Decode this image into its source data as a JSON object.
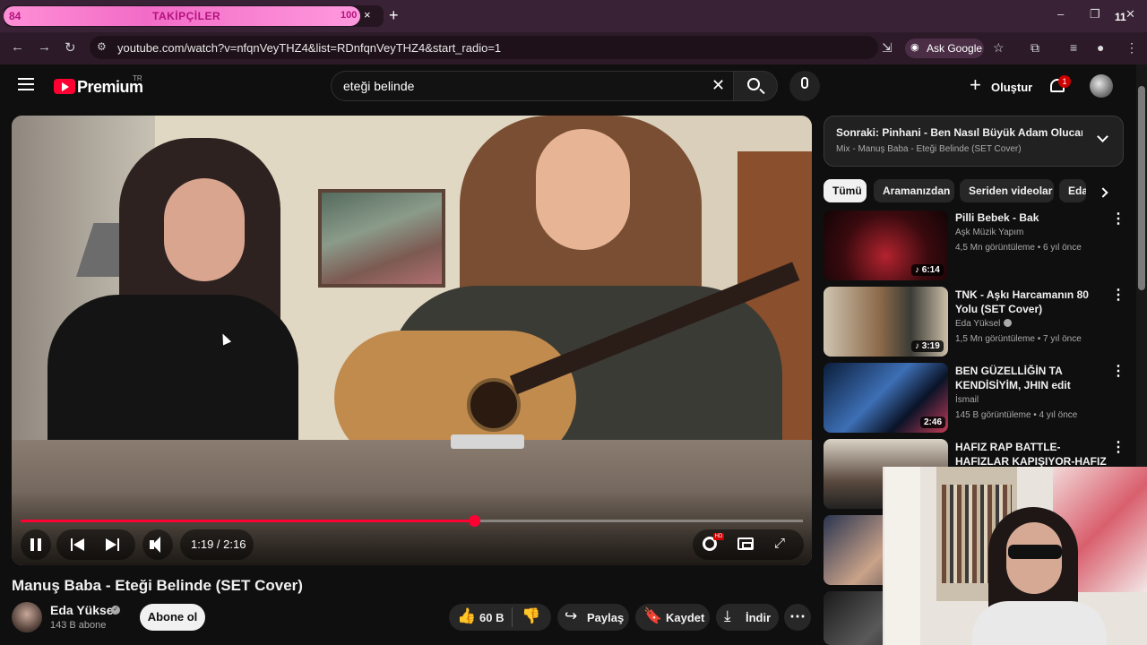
{
  "browser": {
    "tab": {
      "left_count": "84",
      "title": "TAKİPÇİLER",
      "right_count": "100",
      "close": "×"
    },
    "new_tab": "+",
    "window_controls": {
      "minimize": "–",
      "maximize": "❐",
      "close": "✕",
      "badge": "11"
    },
    "nav": {
      "back": "←",
      "forward": "→",
      "reload": "↻"
    },
    "url": "youtube.com/watch?v=nfqnVeyTHZ4&list=RDnfqnVeyTHZ4&start_radio=1",
    "ask_google": "Ask Google"
  },
  "youtube": {
    "logo": {
      "text": "Premium",
      "region": "TR"
    },
    "search": {
      "query": "eteği belinde",
      "clear": "✕"
    },
    "create_label": "Oluştur",
    "create_plus": "+",
    "notification_count": "1"
  },
  "player": {
    "time": "1:19 / 2:16",
    "progress": 0.58,
    "hd_badge": "HD",
    "fullscreen": "⤢"
  },
  "video": {
    "title": "Manuş Baba - Eteği Belinde (SET Cover)",
    "channel": "Eda Yüksel",
    "verified": "✓",
    "subscribers": "143 B abone",
    "subscribe_label": "Abone ol",
    "likes": "60 B",
    "share_label": "Paylaş",
    "save_label": "Kaydet",
    "download_label": "İndir",
    "more": "⋯",
    "icons": {
      "like": "👍",
      "dislike": "👎",
      "share": "↪",
      "save": "🔖",
      "download": "⤓"
    }
  },
  "sidebar": {
    "next": {
      "title": "Sonraki: Pinhani - Ben Nasıl Büyük Adam Olucam (...",
      "subtitle": "Mix - Manuş Baba - Eteği Belinde (SET Cover)"
    },
    "chips": [
      "Tümü",
      "Aramanızdan",
      "Seriden videolar",
      "Eda"
    ],
    "recommendations": [
      {
        "title": "Pilli Bebek - Bak",
        "channel": "Aşk Müzik Yapım",
        "meta": "4,5 Mn görüntüleme • 6 yıl önce",
        "duration": "♪ 6:14",
        "verified": false
      },
      {
        "title": "TNK - Aşkı Harcamanın 80 Yolu (SET Cover)",
        "channel": "Eda Yüksel",
        "meta": "1,5 Mn görüntüleme • 7 yıl önce",
        "duration": "♪ 3:19",
        "verified": true
      },
      {
        "title": "BEN GÜZELLİĞİN TA KENDİSİYİM, JHIN edit",
        "channel": "İsmail",
        "meta": "145 B görüntüleme • 4 yıl önce",
        "duration": "2:46",
        "verified": false
      },
      {
        "title": "HAFIZ RAP BATTLE-HAFIZLAR KAPIŞIYOR-HAFIZ LAF ...",
        "channel": "",
        "meta": "",
        "duration": "",
        "verified": false
      }
    ],
    "more_icon": "⋮"
  },
  "colors": {
    "accent": "#ff0033",
    "background": "#0f0f0f",
    "chip_bg": "#272727",
    "tab_pink": "#f26cc7"
  }
}
